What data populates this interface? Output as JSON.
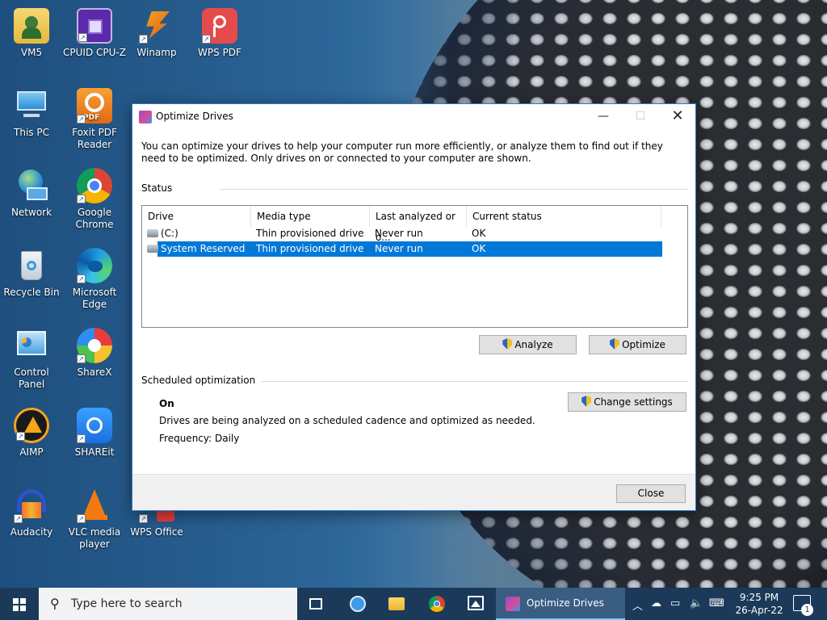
{
  "desktop": {
    "icons": [
      {
        "label": "VM5",
        "icon": "folder-person-icon"
      },
      {
        "label": "CPUID CPU-Z",
        "icon": "cpu-z-icon"
      },
      {
        "label": "Winamp",
        "icon": "winamp-icon"
      },
      {
        "label": "WPS PDF",
        "icon": "wps-pdf-icon"
      },
      {
        "label": "This PC",
        "icon": "computer-icon"
      },
      {
        "label": "Foxit PDF Reader",
        "icon": "foxit-icon"
      },
      {
        "label": "Network",
        "icon": "network-icon"
      },
      {
        "label": "Google Chrome",
        "icon": "chrome-icon"
      },
      {
        "label": "Recycle Bin",
        "icon": "recycle-bin-icon"
      },
      {
        "label": "Microsoft Edge",
        "icon": "edge-icon"
      },
      {
        "label": "Control Panel",
        "icon": "control-panel-icon"
      },
      {
        "label": "ShareX",
        "icon": "sharex-icon"
      },
      {
        "label": "AIMP",
        "icon": "aimp-icon"
      },
      {
        "label": "SHAREit",
        "icon": "shareit-icon"
      },
      {
        "label": "Audacity",
        "icon": "audacity-icon"
      },
      {
        "label": "VLC media player",
        "icon": "vlc-icon"
      },
      {
        "label": "WPS Office",
        "icon": "wps-office-icon"
      }
    ]
  },
  "dialog": {
    "title": "Optimize Drives",
    "intro": "You can optimize your drives to help your computer run more efficiently, or analyze them to find out if they need to be optimized. Only drives on or connected to your computer are shown.",
    "status_label": "Status",
    "columns": [
      "Drive",
      "Media type",
      "Last analyzed or o...",
      "Current status"
    ],
    "drives": [
      {
        "drive": "(C:)",
        "media": "Thin provisioned drive",
        "last": "Never run",
        "status": "OK",
        "selected": false
      },
      {
        "drive": "System Reserved",
        "media": "Thin provisioned drive",
        "last": "Never run",
        "status": "OK",
        "selected": true
      }
    ],
    "analyze_label": "Analyze",
    "optimize_label": "Optimize",
    "scheduled_label": "Scheduled optimization",
    "schedule_state": "On",
    "schedule_desc": "Drives are being analyzed on a scheduled cadence and optimized as needed.",
    "schedule_freq": "Frequency: Daily",
    "change_settings_label": "Change settings",
    "close_label": "Close"
  },
  "taskbar": {
    "search_placeholder": "Type here to search",
    "active_task": "Optimize Drives",
    "time": "9:25 PM",
    "date": "26-Apr-22",
    "notification_count": "1"
  },
  "colors": {
    "accent": "#0078d7",
    "taskbar": "#1b3a5a"
  }
}
